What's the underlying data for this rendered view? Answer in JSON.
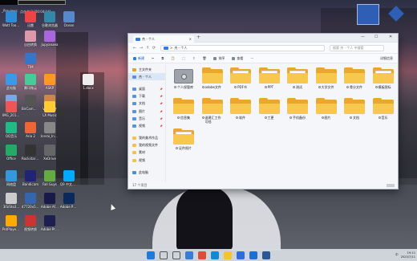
{
  "topbar": {
    "label1": "_Previews",
    "label2": "点击关闭 [00:04:14]"
  },
  "desktop_icons": [
    {
      "label": "Watt Toolkit"
    },
    {
      "label": "迅雷"
    },
    {
      "label": "谷歌浏览器"
    },
    {
      "label": "Ocean"
    },
    {
      "label": "自由转换"
    },
    {
      "label": "Excel 表格"
    },
    {
      "label": "Jupyanaea"
    },
    {
      "label": "TIM"
    },
    {
      "label": "此电脑"
    },
    {
      "label": "腾讯微云"
    },
    {
      "label": "ASKP"
    },
    {
      "label": "1.docx"
    },
    {
      "label": "BirCam软件"
    },
    {
      "label": "Studio"
    },
    {
      "label": "Visit 软件"
    },
    {
      "label": "IMG_2019..."
    },
    {
      "label": "LX Music"
    },
    {
      "label": "QQ音乐"
    },
    {
      "label": "Aria 2"
    },
    {
      "label": "Icerai_In-..."
    },
    {
      "label": "Office"
    },
    {
      "label": "Rockstar Games..."
    },
    {
      "label": "XeDrive"
    },
    {
      "label": "网络盘"
    },
    {
      "label": "Bandicam"
    },
    {
      "label": "Fall Guys"
    },
    {
      "label": "Q9 中文对话"
    },
    {
      "label": "3IS/Sto3..."
    },
    {
      "label": "47720x58..."
    },
    {
      "label": "Adobe After Effects 2023"
    },
    {
      "label": "Adobe Photosho..."
    },
    {
      "label": "PotPlayer 64 bit"
    },
    {
      "label": "视频转换"
    },
    {
      "label": "Adobe Premiere P..."
    }
  ],
  "explorer": {
    "tab_title": "杰 - 个人",
    "new_tab": "+",
    "minimize": "—",
    "maximize": "☐",
    "close": "✕",
    "nav": {
      "back": "←",
      "forward": "→",
      "up": "↑",
      "refresh": "⟳"
    },
    "address": "杰 - 个人",
    "address_sep": ">",
    "search_placeholder": "搜索 杰 - 个人 中搜索",
    "commands": {
      "new": "新建",
      "cut": "✂",
      "copy": "⧉",
      "paste": "📋",
      "rename": "⬚",
      "share": "⇪",
      "delete": "🗑",
      "sort": "排序",
      "view": "查看",
      "more": "···",
      "details": "详细信息"
    },
    "sidebar": [
      {
        "label": "主文件夹",
        "icon": "home-icon",
        "selected": false
      },
      {
        "label": "杰 - 个人",
        "icon": "cloud-icon",
        "selected": true
      },
      {
        "label": "桌面",
        "icon": "desktop-icon",
        "selected": false,
        "pinned": true
      },
      {
        "label": "下载",
        "icon": "download-icon",
        "selected": false,
        "pinned": true
      },
      {
        "label": "文档",
        "icon": "document-icon",
        "selected": false,
        "pinned": true
      },
      {
        "label": "图片",
        "icon": "picture-icon",
        "selected": false,
        "pinned": true
      },
      {
        "label": "音乐",
        "icon": "music-icon",
        "selected": false,
        "pinned": true
      },
      {
        "label": "视频",
        "icon": "video-icon",
        "selected": false,
        "pinned": true
      },
      {
        "label": "我的美术作品",
        "icon": "folder-icon",
        "selected": false
      },
      {
        "label": "我的视频文件",
        "icon": "folder-icon",
        "selected": false
      },
      {
        "label": "素材",
        "icon": "folder-icon",
        "selected": false
      },
      {
        "label": "视频",
        "icon": "folder-icon",
        "selected": false
      },
      {
        "label": "此电脑",
        "icon": "computer-icon",
        "selected": false
      }
    ],
    "files": [
      {
        "label": "个人保管库",
        "type": "vault"
      },
      {
        "label": "adobe文件",
        "type": "folder"
      },
      {
        "label": "PDF书",
        "type": "folder-doc"
      },
      {
        "label": "PPT",
        "type": "folder-doc"
      },
      {
        "label": "测试",
        "type": "folder-doc"
      },
      {
        "label": "大学文件",
        "type": "folder"
      },
      {
        "label": "骨分文件",
        "type": "folder"
      },
      {
        "label": "模板图标",
        "type": "folder-doc"
      },
      {
        "label": "信息集",
        "type": "folder"
      },
      {
        "label": "谁建汇工作可档",
        "type": "folder"
      },
      {
        "label": "软件",
        "type": "folder"
      },
      {
        "label": "工更",
        "type": "folder"
      },
      {
        "label": "手机备份",
        "type": "folder"
      },
      {
        "label": "图片",
        "type": "folder"
      },
      {
        "label": "文档",
        "type": "folder"
      },
      {
        "label": "音乐",
        "type": "folder"
      },
      {
        "label": "证件照片",
        "type": "folder-doc"
      }
    ],
    "status": "17 个项目"
  },
  "taskbar": {
    "apps": [
      "windows-icon",
      "search-icon",
      "task-view-icon",
      "widgets-icon",
      "chrome-icon",
      "edge-icon",
      "explorer-icon",
      "store-icon",
      "mail-icon",
      "word-icon"
    ],
    "tray": {
      "lang": "中",
      "time": "19:11",
      "date": "2023/7/11"
    }
  }
}
